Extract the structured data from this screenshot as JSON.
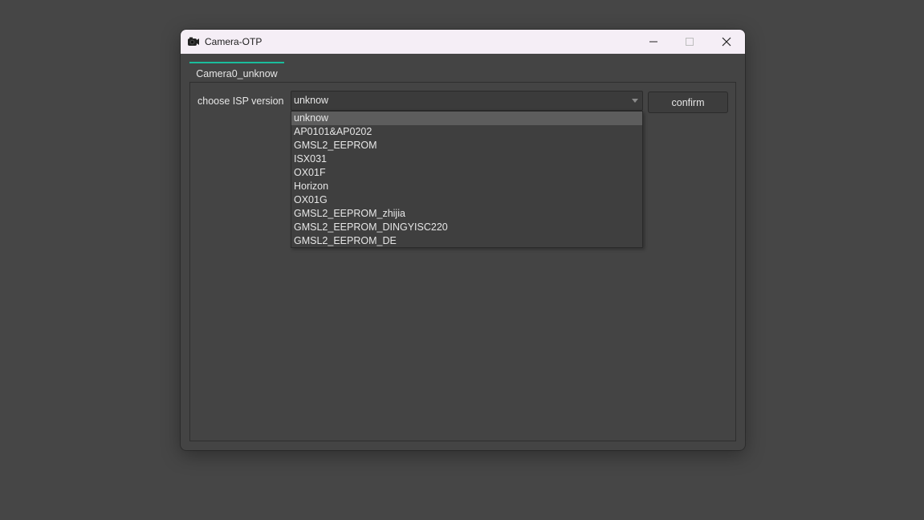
{
  "window": {
    "title": "Camera-OTP"
  },
  "tab": {
    "label": "Camera0_unknow"
  },
  "isp": {
    "label": "choose ISP version",
    "selected_value": "unknow",
    "confirm_label": "confirm",
    "options": [
      "unknow",
      "AP0101&AP0202",
      "GMSL2_EEPROM",
      "ISX031",
      "OX01F",
      "Horizon",
      "OX01G",
      "GMSL2_EEPROM_zhijia",
      "GMSL2_EEPROM_DINGYISC220",
      "GMSL2_EEPROM_DE"
    ]
  },
  "colors": {
    "tab_accent": "#1abc9c",
    "titlebar_bg": "#f5eef6",
    "window_bg": "#444444"
  }
}
